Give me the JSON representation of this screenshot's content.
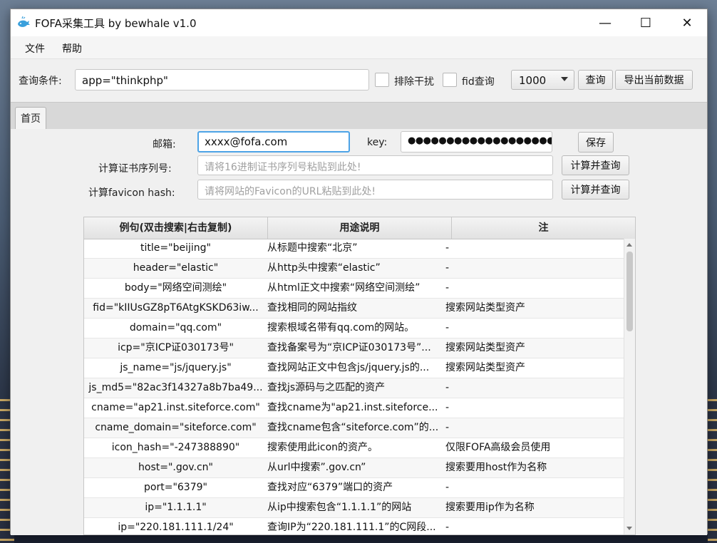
{
  "window": {
    "title": "FOFA采集工具 by bewhale v1.0",
    "controls": {
      "minimize": "—",
      "maximize": "☐",
      "close": "✕"
    }
  },
  "menu": {
    "items": [
      "文件",
      "帮助"
    ]
  },
  "toolbar": {
    "query_label": "查询条件:",
    "query_value": "app=\"thinkphp\"",
    "exclude_label": "排除干扰",
    "fid_label": "fid查询",
    "count_value": "1000",
    "query_button": "查询",
    "export_button": "导出当前数据"
  },
  "tabs": [
    {
      "label": "首页"
    }
  ],
  "form": {
    "email_label": "邮箱:",
    "email_value": "xxxx@fofa.com",
    "key_label": "key:",
    "key_value": "●●●●●●●●●●●●●●●●●●●●●",
    "save_button": "保存",
    "cert_label": "计算证书序列号:",
    "cert_placeholder": "请将16进制证书序列号粘贴到此处!",
    "cert_button": "计算并查询",
    "favicon_label": "计算favicon hash:",
    "favicon_placeholder": "请将网站的Favicon的URL粘贴到此处!",
    "favicon_button": "计算并查询"
  },
  "table": {
    "headers": [
      "例句(双击搜索|右击复制)",
      "用途说明",
      "注"
    ],
    "rows": [
      [
        "title=\"beijing\"",
        "从标题中搜索“北京”",
        "-"
      ],
      [
        "header=\"elastic\"",
        "从http头中搜索“elastic”",
        "-"
      ],
      [
        "body=\"网络空间测绘\"",
        "从html正文中搜索“网络空间测绘”",
        "-"
      ],
      [
        "fid=\"kIIUsGZ8pT6AtgKSKD63iw...",
        "查找相同的网站指纹",
        "搜索网站类型资产"
      ],
      [
        "domain=\"qq.com\"",
        "搜索根域名带有qq.com的网站。",
        "-"
      ],
      [
        "icp=\"京ICP证030173号\"",
        "查找备案号为“京ICP证030173号”...",
        "搜索网站类型资产"
      ],
      [
        "js_name=\"js/jquery.js\"",
        "查找网站正文中包含js/jquery.js的...",
        "搜索网站类型资产"
      ],
      [
        "js_md5=\"82ac3f14327a8b7ba49...",
        "查找js源码与之匹配的资产",
        "-"
      ],
      [
        "cname=\"ap21.inst.siteforce.com\"",
        "查找cname为\"ap21.inst.siteforce...",
        "-"
      ],
      [
        "cname_domain=\"siteforce.com\"",
        "查找cname包含“siteforce.com”的...",
        "-"
      ],
      [
        "icon_hash=\"-247388890\"",
        "搜索使用此icon的资产。",
        "仅限FOFA高级会员使用"
      ],
      [
        "host=\".gov.cn\"",
        "从url中搜索”.gov.cn”",
        "搜索要用host作为名称"
      ],
      [
        "port=\"6379\"",
        "查找对应“6379”端口的资产",
        "-"
      ],
      [
        "ip=\"1.1.1.1\"",
        "从ip中搜索包含“1.1.1.1”的网站",
        "搜索要用ip作为名称"
      ],
      [
        "ip=\"220.181.111.1/24\"",
        "查询IP为“220.181.111.1”的C网段...",
        "-"
      ]
    ]
  }
}
